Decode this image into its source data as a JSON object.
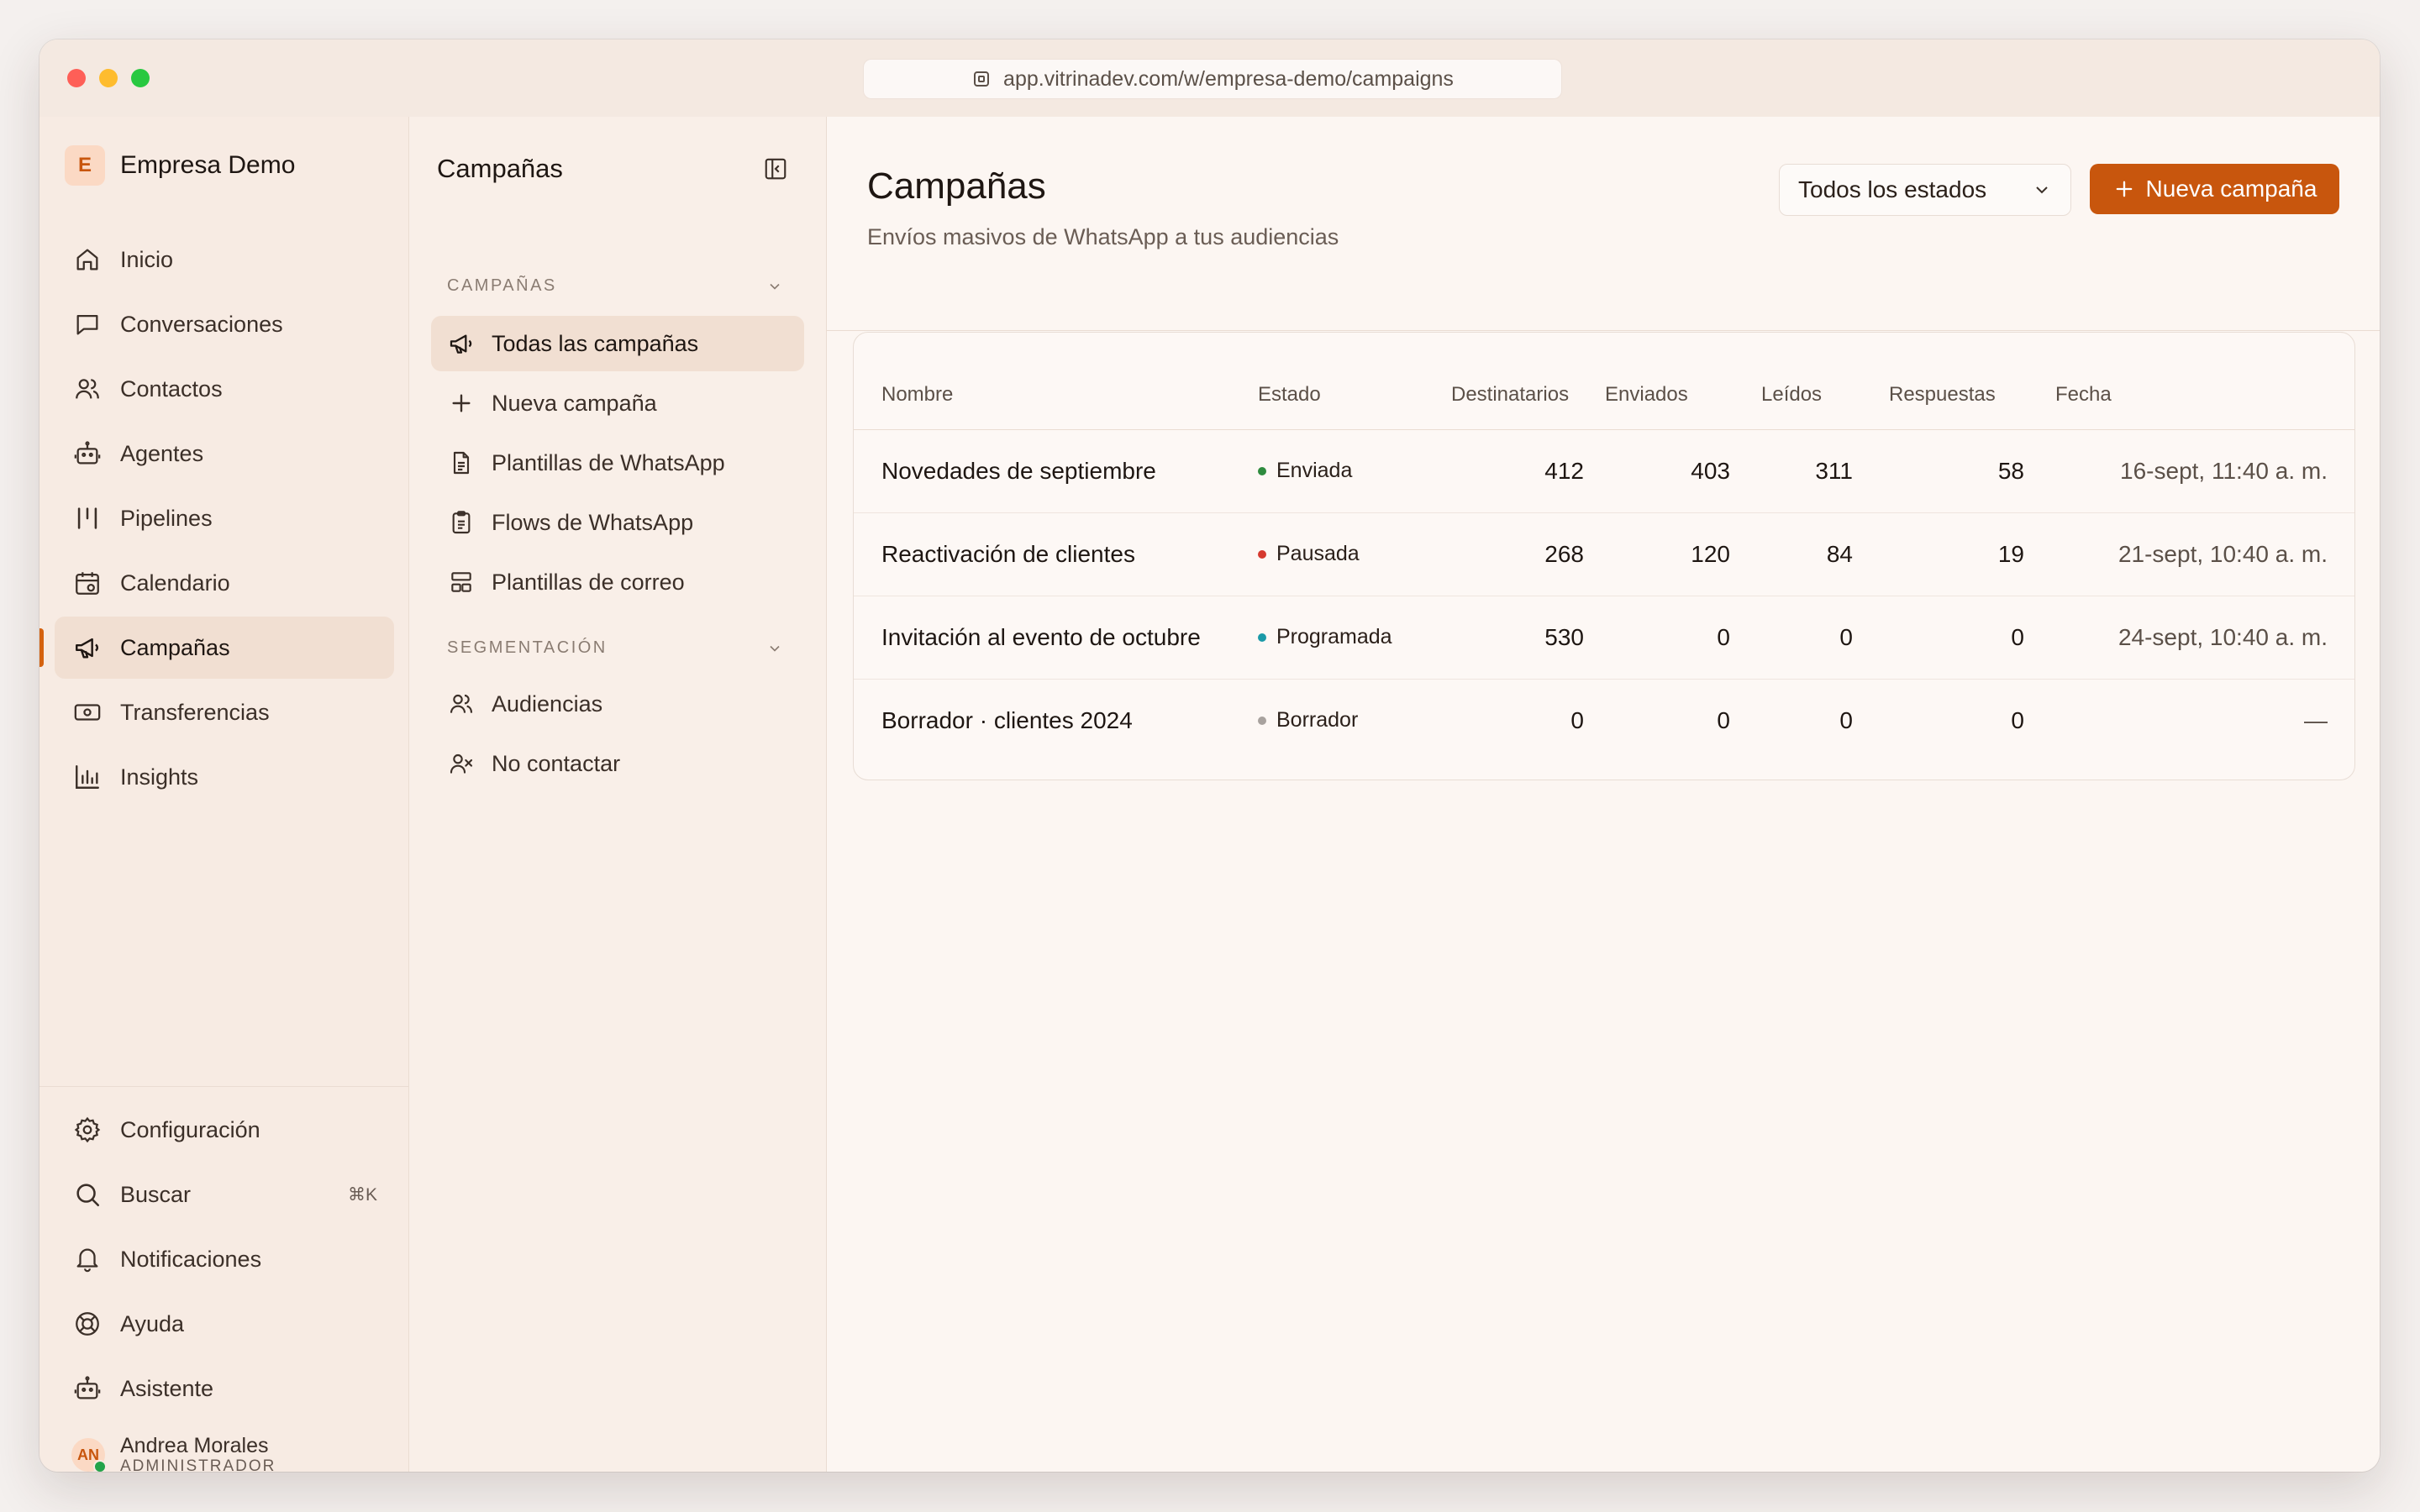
{
  "browser": {
    "url": "app.vitrinadev.com/w/empresa-demo/campaigns"
  },
  "org": {
    "initial": "E",
    "name": "Empresa Demo"
  },
  "nav": {
    "items": [
      {
        "label": "Inicio",
        "icon": "home-icon"
      },
      {
        "label": "Conversaciones",
        "icon": "chat-icon"
      },
      {
        "label": "Contactos",
        "icon": "users-icon"
      },
      {
        "label": "Agentes",
        "icon": "bot-icon"
      },
      {
        "label": "Pipelines",
        "icon": "pipeline-icon"
      },
      {
        "label": "Calendario",
        "icon": "calendar-icon"
      },
      {
        "label": "Campañas",
        "icon": "megaphone-icon",
        "active": true
      },
      {
        "label": "Transferencias",
        "icon": "money-icon"
      },
      {
        "label": "Insights",
        "icon": "chart-icon"
      }
    ],
    "bottom": [
      {
        "label": "Configuración",
        "icon": "gear-icon"
      },
      {
        "label": "Buscar",
        "icon": "search-icon",
        "shortcut": "⌘K"
      },
      {
        "label": "Notificaciones",
        "icon": "bell-icon"
      },
      {
        "label": "Ayuda",
        "icon": "lifebuoy-icon"
      },
      {
        "label": "Asistente",
        "icon": "bot-icon"
      }
    ]
  },
  "user": {
    "initials": "AN",
    "name": "Andrea Morales",
    "role": "ADMINISTRADOR"
  },
  "subnav": {
    "title": "Campañas",
    "section1": "CAMPAÑAS",
    "items1": [
      {
        "label": "Todas las campañas",
        "icon": "megaphone-icon",
        "active": true
      },
      {
        "label": "Nueva campaña",
        "icon": "plus-icon"
      },
      {
        "label": "Plantillas de WhatsApp",
        "icon": "document-icon"
      },
      {
        "label": "Flows de WhatsApp",
        "icon": "clipboard-icon"
      },
      {
        "label": "Plantillas de correo",
        "icon": "layout-icon"
      }
    ],
    "section2": "SEGMENTACIÓN",
    "items2": [
      {
        "label": "Audiencias",
        "icon": "users-icon"
      },
      {
        "label": "No contactar",
        "icon": "user-x-icon"
      }
    ]
  },
  "main": {
    "title": "Campañas",
    "subtitle": "Envíos masivos de WhatsApp a tus audiencias",
    "filter": "Todos los estados",
    "new_button": "Nueva campaña"
  },
  "table": {
    "headers": {
      "name": "Nombre",
      "status": "Estado",
      "recipients": "Destinatarios",
      "sent": "Enviados",
      "read": "Leídos",
      "replies": "Respuestas",
      "date": "Fecha"
    },
    "rows": [
      {
        "name": "Novedades de septiembre",
        "status": "Enviada",
        "status_color": "#2e8b3e",
        "recipients": "412",
        "sent": "403",
        "read": "311",
        "replies": "58",
        "date": "16-sept, 11:40 a. m."
      },
      {
        "name": "Reactivación de clientes",
        "status": "Pausada",
        "status_color": "#d63a2f",
        "recipients": "268",
        "sent": "120",
        "read": "84",
        "replies": "19",
        "date": "21-sept, 10:40 a. m."
      },
      {
        "name": "Invitación al evento de octubre",
        "status": "Programada",
        "status_color": "#1b9aa8",
        "recipients": "530",
        "sent": "0",
        "read": "0",
        "replies": "0",
        "date": "24-sept, 10:40 a. m."
      },
      {
        "name": "Borrador · clientes 2024",
        "status": "Borrador",
        "status_color": "#a8a29e",
        "recipients": "0",
        "sent": "0",
        "read": "0",
        "replies": "0",
        "date": "—"
      }
    ]
  },
  "colors": {
    "accent": "#c8560d",
    "sidebar_bg": "#f7ebe3",
    "active_bg": "#f1dfd2"
  }
}
